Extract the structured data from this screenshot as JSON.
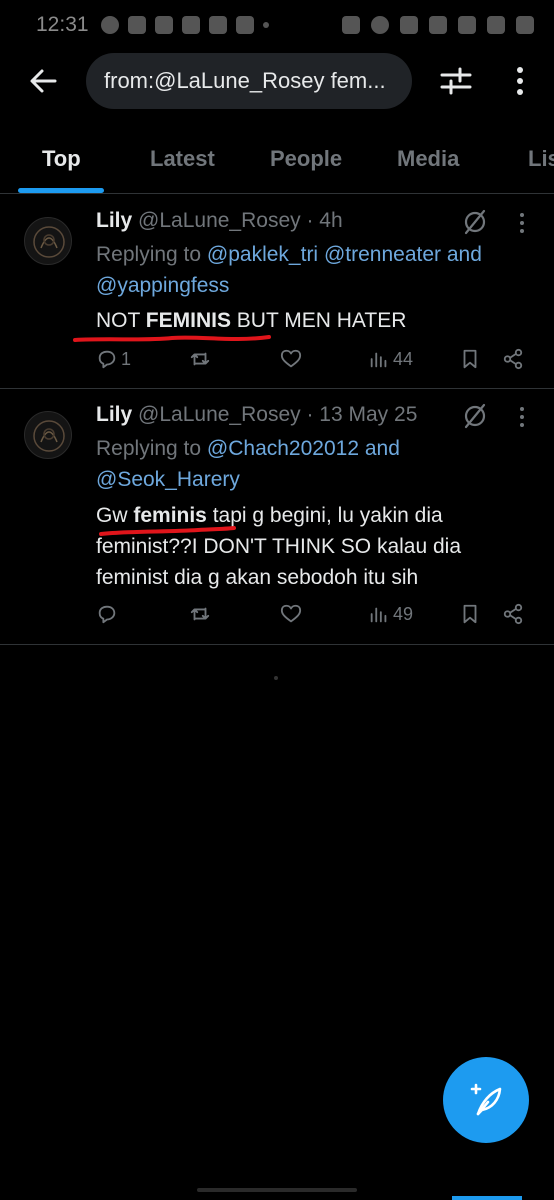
{
  "status_bar": {
    "time": "12:31"
  },
  "search": {
    "query": "from:@LaLune_Rosey fem..."
  },
  "tabs": [
    {
      "label": "Top",
      "active": true
    },
    {
      "label": "Latest",
      "active": false
    },
    {
      "label": "People",
      "active": false
    },
    {
      "label": "Media",
      "active": false
    },
    {
      "label": "Lis",
      "active": false
    }
  ],
  "tweets": [
    {
      "name": "Lily",
      "handle": "@LaLune_Rosey",
      "time": "· 4h",
      "replying_prefix": "Replying to",
      "mention1": "@paklek_tri",
      "mention2": "@trenneater",
      "joiner": "and",
      "mention3": "@yappingfess",
      "text_pre": "NOT ",
      "text_bold": "FEMINIS",
      "text_post": " BUT MEN HATER",
      "replies": "1",
      "views": "44"
    },
    {
      "name": "Lily",
      "handle": "@LaLune_Rosey",
      "time": "· 13 May 25",
      "replying_prefix": "Replying to",
      "mention1": "@Chach202012",
      "joiner": "and",
      "mention2": "@Seok_Harery",
      "text_pre": "Gw ",
      "text_bold": "feminis",
      "text_post": " tapi g begini, lu yakin dia feminist??I DON'T THINK SO kalau dia feminist dia g akan sebodoh itu sih",
      "replies": "",
      "views": "49"
    }
  ],
  "colors": {
    "accent": "#1d9bf0",
    "mention": "#6ea8dd",
    "muted": "#71767b",
    "annotation": "#e0151b"
  }
}
